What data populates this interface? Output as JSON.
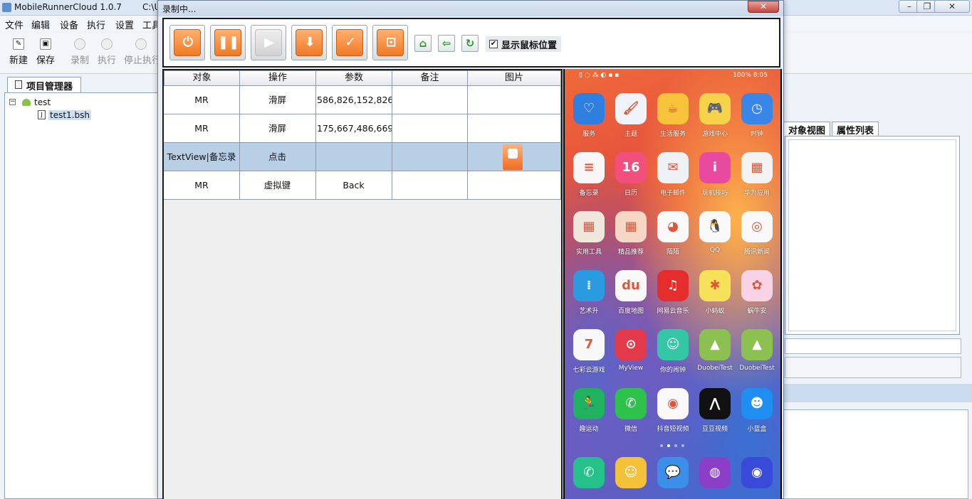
{
  "main_window": {
    "title": "MobileRunnerCloud 1.0.7",
    "path_fragment": "C:\\U",
    "minimize": "–",
    "restore": "❐",
    "close": "✕"
  },
  "menu": [
    "文件",
    "编辑",
    "设备",
    "执行",
    "设置",
    "工具"
  ],
  "toolbar": {
    "new_label": "新建",
    "save_label": "保存",
    "record_label": "录制",
    "run_label": "执行",
    "stop_label": "停止执行"
  },
  "project_panel": {
    "tab_label": "项目管理器",
    "tree_root": "test",
    "tree_file": "test1.bsh",
    "collapse_glyph": "−"
  },
  "right_panel": {
    "tabs": [
      "对象视图",
      "属性列表"
    ]
  },
  "dialog": {
    "title": "录制中...",
    "close_glyph": "✕",
    "record_buttons": [
      {
        "name": "stop-record",
        "glyph": "⏻",
        "enabled": true
      },
      {
        "name": "pause-record",
        "glyph": "❚❚",
        "enabled": true
      },
      {
        "name": "play",
        "glyph": "▶",
        "enabled": false
      },
      {
        "name": "save-record",
        "glyph": "⬇",
        "enabled": true
      },
      {
        "name": "check-point",
        "glyph": "✓",
        "enabled": true
      },
      {
        "name": "screenshot",
        "glyph": "⊡",
        "enabled": true
      }
    ],
    "nav_buttons": [
      {
        "name": "home",
        "glyph": "⌂"
      },
      {
        "name": "back",
        "glyph": "⇦"
      },
      {
        "name": "refresh",
        "glyph": "↻"
      }
    ],
    "show_mouse_checkbox": {
      "label": "显示鼠标位置",
      "checked": true,
      "mark": "✔"
    }
  },
  "table": {
    "headers": [
      "对象",
      "操作",
      "参数",
      "备注",
      "图片"
    ],
    "rows": [
      {
        "object": "MR",
        "action": "滑屏",
        "param": "586,826,152,826...",
        "note": "",
        "has_image": false
      },
      {
        "object": "MR",
        "action": "滑屏",
        "param": "175,667,486,669...",
        "note": "",
        "has_image": false
      },
      {
        "object": "TextView|备忘录",
        "action": "点击",
        "param": "",
        "note": "",
        "has_image": true
      },
      {
        "object": "MR",
        "action": "虚拟键",
        "param": "Back",
        "note": "",
        "has_image": false
      }
    ]
  },
  "phone": {
    "status_right": "100% 8:05",
    "apps": [
      {
        "label": "服务",
        "color": "#2f7fe0",
        "glyph": "♡"
      },
      {
        "label": "主题",
        "color": "#f0f4fa",
        "glyph": "🖌"
      },
      {
        "label": "生活服务",
        "color": "#f6c33a",
        "glyph": "☕"
      },
      {
        "label": "游戏中心",
        "color": "#f5d24a",
        "glyph": "🎮"
      },
      {
        "label": "时钟",
        "color": "#3a86e8",
        "glyph": "◷"
      },
      {
        "label": "备忘录",
        "color": "#f7f7f7",
        "glyph": "≡"
      },
      {
        "label": "日历",
        "color": "#f34f7d",
        "glyph": "16"
      },
      {
        "label": "电子邮件",
        "color": "#eef2f7",
        "glyph": "✉"
      },
      {
        "label": "玩机技巧",
        "color": "#e84aa0",
        "glyph": "i"
      },
      {
        "label": "华为应用",
        "color": "#f3f3f3",
        "glyph": "▦"
      },
      {
        "label": "实用工具",
        "color": "#f0e7dc",
        "glyph": "▦"
      },
      {
        "label": "精品推荐",
        "color": "#f6d6c4",
        "glyph": "▦"
      },
      {
        "label": "陌陌",
        "color": "#f9f9f9",
        "glyph": "◕"
      },
      {
        "label": "QQ",
        "color": "#f9f9f9",
        "glyph": "🐧"
      },
      {
        "label": "腾讯新闻",
        "color": "#f9f9f9",
        "glyph": "◎"
      },
      {
        "label": "艺术升",
        "color": "#2a9be0",
        "glyph": "⁞"
      },
      {
        "label": "百度地图",
        "color": "#f9f9f9",
        "glyph": "du"
      },
      {
        "label": "网易云音乐",
        "color": "#e62d2d",
        "glyph": "♫"
      },
      {
        "label": "小蚂蚁",
        "color": "#f7e15a",
        "glyph": "✱"
      },
      {
        "label": "蜗牛安",
        "color": "#f8d3e6",
        "glyph": "✿"
      },
      {
        "label": "七彩云游戏",
        "color": "#f8f8f8",
        "glyph": "7"
      },
      {
        "label": "MyView",
        "color": "#e23a4b",
        "glyph": "⊙"
      },
      {
        "label": "你的闹钟",
        "color": "#33c7a5",
        "glyph": "☺"
      },
      {
        "label": "DuobeiTest",
        "color": "#8cc152",
        "glyph": "▲"
      },
      {
        "label": "DuobeiTest",
        "color": "#8cc152",
        "glyph": "▲"
      },
      {
        "label": "趣运动",
        "color": "#20b25f",
        "glyph": "🏃"
      },
      {
        "label": "微信",
        "color": "#2ec24c",
        "glyph": "✆"
      },
      {
        "label": "抖音短视频",
        "color": "#f9f9f9",
        "glyph": "◉"
      },
      {
        "label": "豆豆视频",
        "color": "#111111",
        "glyph": "⋀"
      },
      {
        "label": "小蓝盒",
        "color": "#1e8ef0",
        "glyph": "☻"
      }
    ],
    "dock": [
      {
        "color": "#26c08a",
        "glyph": "✆"
      },
      {
        "color": "#f4c13a",
        "glyph": "☺"
      },
      {
        "color": "#3b8fe8",
        "glyph": "💬"
      },
      {
        "color": "#8b3fc9",
        "glyph": "◍"
      },
      {
        "color": "#3a4ad8",
        "glyph": "◉"
      }
    ]
  }
}
